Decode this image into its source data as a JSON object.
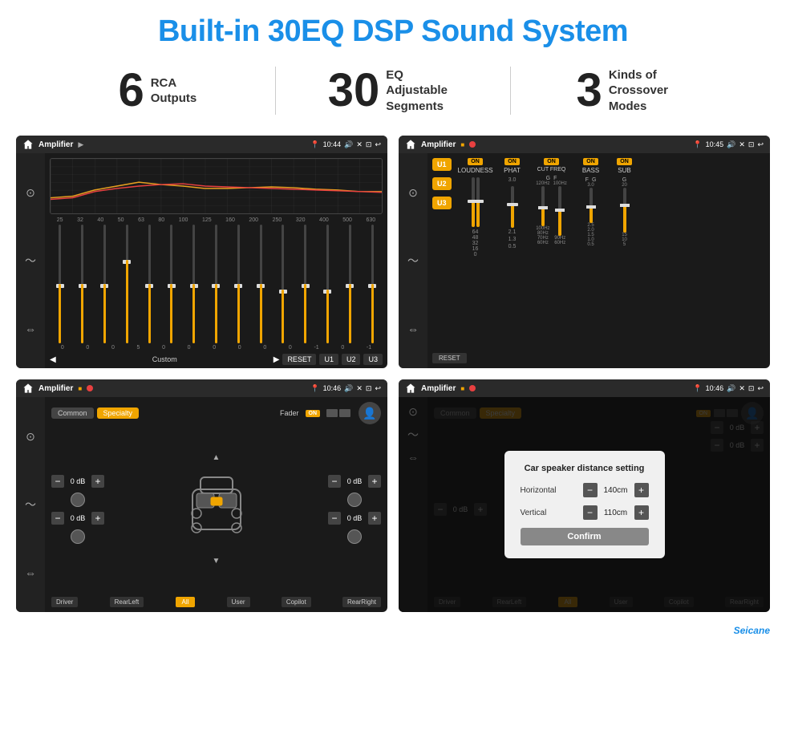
{
  "header": {
    "title": "Built-in 30EQ DSP Sound System",
    "title_color": "#1a8fe8"
  },
  "stats": [
    {
      "number": "6",
      "label": "RCA\nOutputs"
    },
    {
      "number": "30",
      "label": "EQ Adjustable\nSegments"
    },
    {
      "number": "3",
      "label": "Kinds of\nCrossover Modes"
    }
  ],
  "screens": {
    "eq": {
      "status_time": "10:44",
      "app_title": "Amplifier",
      "freq_labels": [
        "25",
        "32",
        "40",
        "50",
        "63",
        "80",
        "100",
        "125",
        "160",
        "200",
        "250",
        "320",
        "400",
        "500",
        "630"
      ],
      "eq_values": [
        "0",
        "0",
        "0",
        "5",
        "0",
        "0",
        "0",
        "0",
        "0",
        "0",
        "-1",
        "0",
        "-1"
      ],
      "bottom_buttons": [
        "RESET",
        "U1",
        "U2",
        "U3"
      ],
      "custom_label": "Custom"
    },
    "amp": {
      "status_time": "10:45",
      "app_title": "Amplifier",
      "channels": [
        "LOUDNESS",
        "PHAT",
        "CUT FREQ",
        "BASS",
        "SUB"
      ],
      "u_buttons": [
        "U1",
        "U2",
        "U3"
      ],
      "reset_label": "RESET"
    },
    "fader": {
      "status_time": "10:46",
      "app_title": "Amplifier",
      "tabs": [
        "Common",
        "Specialty"
      ],
      "on_label": "ON",
      "fader_label": "Fader",
      "db_values": [
        "0 dB",
        "0 dB",
        "0 dB",
        "0 dB"
      ],
      "bottom_buttons": [
        "Driver",
        "RearLeft",
        "All",
        "User",
        "Copilot",
        "RearRight"
      ]
    },
    "distance": {
      "status_time": "10:46",
      "app_title": "Amplifier",
      "tabs": [
        "Common",
        "Specialty"
      ],
      "modal": {
        "title": "Car speaker distance setting",
        "horizontal_label": "Horizontal",
        "horizontal_value": "140cm",
        "vertical_label": "Vertical",
        "vertical_value": "110cm",
        "confirm_label": "Confirm"
      },
      "bottom_buttons": [
        "Driver",
        "RearLeft",
        "User",
        "Copilot",
        "RearRight"
      ],
      "db_values": [
        "0 dB",
        "0 dB"
      ]
    }
  },
  "watermark": "Seicane"
}
